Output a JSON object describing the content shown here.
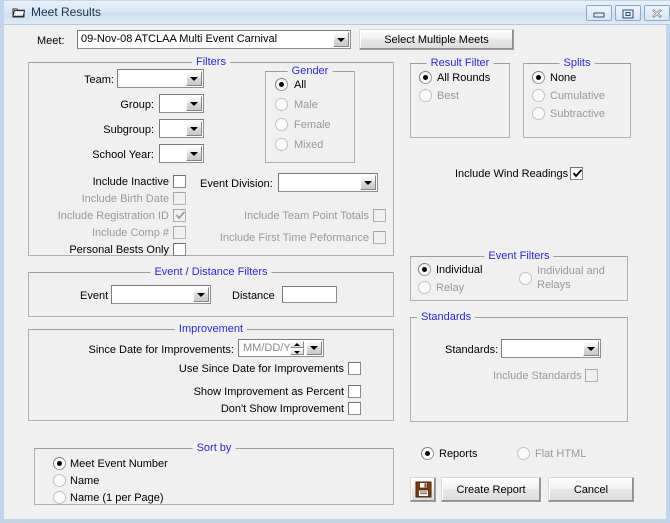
{
  "window": {
    "title": "Meet Results",
    "icon": "folder-icon",
    "buttons": {
      "minimize": "minimize-icon",
      "maximize": "restore-icon",
      "close": "close-icon"
    }
  },
  "meet": {
    "label": "Meet:",
    "value": "09-Nov-08 ATCLAA Multi Event Carnival",
    "select_multiple_button": "Select Multiple Meets"
  },
  "filters": {
    "title": "Filters",
    "team_label": "Team:",
    "team_value": "",
    "group_label": "Group:",
    "group_value": "",
    "subgroup_label": "Subgroup:",
    "subgroup_value": "",
    "school_year_label": "School Year:",
    "school_year_value": "",
    "gender": {
      "title": "Gender",
      "options": [
        {
          "label": "All",
          "selected": true,
          "enabled": true
        },
        {
          "label": "Male",
          "selected": false,
          "enabled": false
        },
        {
          "label": "Female",
          "selected": false,
          "enabled": false
        },
        {
          "label": "Mixed",
          "selected": false,
          "enabled": false
        }
      ]
    },
    "checks_left": [
      {
        "label": "Include Inactive",
        "checked": false,
        "enabled": true
      },
      {
        "label": "Include Birth Date",
        "checked": false,
        "enabled": false
      },
      {
        "label": "Include Registration ID",
        "checked": true,
        "enabled": false
      },
      {
        "label": "Include Comp #",
        "checked": false,
        "enabled": false
      },
      {
        "label": "Personal Bests Only",
        "checked": false,
        "enabled": true
      }
    ],
    "event_division_label": "Event Division:",
    "event_division_value": "",
    "checks_right": [
      {
        "label": "Include Team Point Totals",
        "checked": false,
        "enabled": false
      },
      {
        "label": "Include First Time Peformance",
        "checked": false,
        "enabled": false
      }
    ]
  },
  "result_filter": {
    "title": "Result Filter",
    "options": [
      {
        "label": "All Rounds",
        "selected": true,
        "enabled": true
      },
      {
        "label": "Best",
        "selected": false,
        "enabled": false
      }
    ]
  },
  "splits": {
    "title": "Splits",
    "options": [
      {
        "label": "None",
        "selected": true,
        "enabled": true
      },
      {
        "label": "Cumulative",
        "selected": false,
        "enabled": false
      },
      {
        "label": "Subtractive",
        "selected": false,
        "enabled": false
      }
    ]
  },
  "wind": {
    "label": "Include Wind Readings",
    "checked": true,
    "enabled": true
  },
  "event_distance": {
    "title": "Event / Distance Filters",
    "event_label": "Event",
    "event_value": "",
    "distance_label": "Distance",
    "distance_value": ""
  },
  "improvement": {
    "title": "Improvement",
    "since_date_label": "Since Date for Improvements:",
    "since_date_value": "MM/DD/YY",
    "checks": [
      {
        "label": "Use Since Date for Improvements",
        "checked": false,
        "enabled": true
      },
      {
        "label": "Show Improvement as Percent",
        "checked": false,
        "enabled": true
      },
      {
        "label": "Don't Show Improvement",
        "checked": false,
        "enabled": true
      }
    ]
  },
  "event_filters": {
    "title": "Event Filters",
    "options": [
      {
        "label": "Individual",
        "selected": true,
        "enabled": true
      },
      {
        "label": "Relay",
        "selected": false,
        "enabled": false
      },
      {
        "label": "Individual and Relays",
        "selected": false,
        "enabled": false
      }
    ]
  },
  "standards": {
    "title": "Standards",
    "select_label": "Standards:",
    "select_value": "",
    "include_label": "Include Standards",
    "include_checked": false,
    "include_enabled": false
  },
  "sort_by": {
    "title": "Sort by",
    "options": [
      {
        "label": "Meet Event Number",
        "selected": true,
        "enabled": true
      },
      {
        "label": "Name",
        "selected": false,
        "enabled": false
      },
      {
        "label": "Name (1 per Page)",
        "selected": false,
        "enabled": false
      }
    ]
  },
  "output": {
    "options": [
      {
        "label": "Reports",
        "selected": true,
        "enabled": true
      },
      {
        "label": "Flat HTML",
        "selected": false,
        "enabled": false
      }
    ],
    "save_icon": "floppy-disk-icon",
    "create_report_button": "Create Report",
    "cancel_button": "Cancel"
  },
  "colors": {
    "group_title": "#2a2ad0",
    "window_bg": "#f0f0f0",
    "titlebar": "#dce8f4",
    "disabled_text": "#9a9a9a"
  }
}
